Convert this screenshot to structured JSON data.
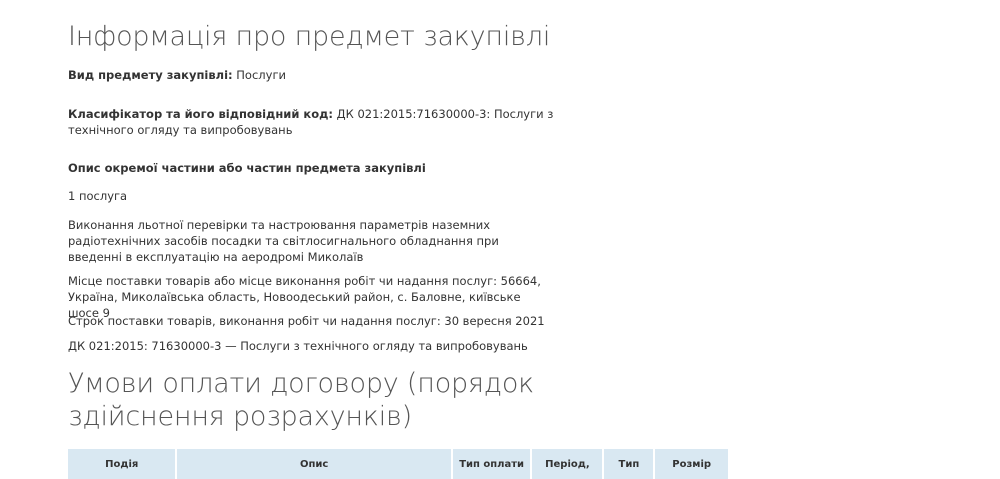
{
  "procurement_subject": {
    "title": "Інформація про предмет закупівлі",
    "type_label": "Вид предмету закупівлі:",
    "type_value": "Послуги",
    "classifier_label": "Класифікатор та його відповідний код:",
    "classifier_value": "ДК 021:2015:71630000-3: Послуги з технічного огляду та випробовувань",
    "lot_heading": "Опис окремої частини або частин предмета закупівлі",
    "quantity": "1 послуга",
    "description": "Виконання льотної перевірки та настроювання параметрів наземних радіотехнічних засобів посадки та світлосигнального обладнання при введенні в експлуатацію на аеродромі Миколаїв",
    "delivery_place": "Місце поставки товарів або місце виконання робіт чи надання послуг: 56664, Україна, Миколаївська область, Новоодеський район, с. Баловне, київське шосе 9",
    "delivery_date": "Строк поставки товарів, виконання робіт чи надання послуг: 30 вересня 2021",
    "cpv": "ДК 021:2015: 71630000-3 — Послуги з технічного огляду та випробовувань"
  },
  "payment_terms": {
    "title": "Умови оплати договору (порядок здійснення розрахунків)",
    "columns": [
      "Подія",
      "Опис",
      "Тип оплати",
      "Період,",
      "Тип",
      "Розмір"
    ]
  }
}
